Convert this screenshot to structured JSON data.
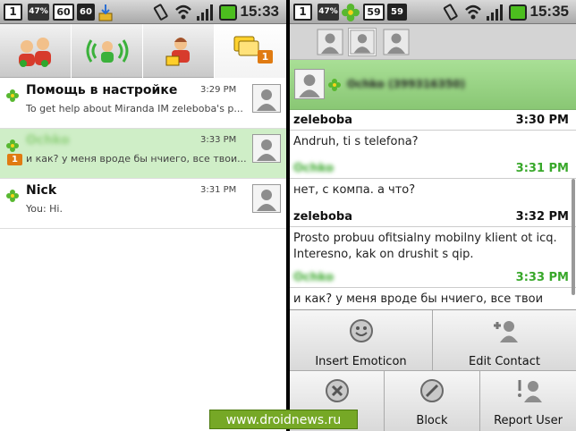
{
  "left_screen": {
    "status": {
      "notif_count": "1",
      "battery": "47%",
      "box1": "60",
      "box2": "60",
      "time": "15:33"
    },
    "tabs": [
      {
        "name": "contacts-tab"
      },
      {
        "name": "status-tab"
      },
      {
        "name": "account-tab"
      },
      {
        "name": "chats-tab",
        "badge": "1"
      }
    ],
    "chats": [
      {
        "name": "Помощь в настройке",
        "time": "3:29 PM",
        "preview": "To get help about Miranda IM zeleboba's p..."
      },
      {
        "name": "Ochko",
        "time": "3:33 PM",
        "preview": "и как? у меня вроде бы нчиего, все твои...",
        "badge": "1"
      },
      {
        "name": "Nick",
        "time": "3:31 PM",
        "preview": "You: Hi."
      }
    ]
  },
  "right_screen": {
    "status": {
      "notif_count": "1",
      "battery": "47%",
      "box1": "59",
      "box2": "59",
      "time": "15:35"
    },
    "contact": {
      "name": "Ochko (399316350)"
    },
    "messages": [
      {
        "from": "zeleboba",
        "time": "3:30 PM",
        "text": "Andruh, ti s telefona?",
        "mine": true
      },
      {
        "from": "Ochko",
        "time": "3:31 PM",
        "text": "нет, с компа. а что?",
        "mine": false
      },
      {
        "from": "zeleboba",
        "time": "3:32 PM",
        "text": "Prosto probuu ofitsialny mobilny klient ot icq. Interesno, kak on drushit s qip.",
        "mine": true
      },
      {
        "from": "Ochko",
        "time": "3:33 PM",
        "text": "и как? у меня вроде бы нчиего, все твои",
        "mine": false
      }
    ],
    "menu": {
      "insert_emoticon": "Insert Emoticon",
      "edit_contact": "Edit Contact",
      "close": "Close",
      "block": "Block",
      "report_user": "Report User"
    }
  },
  "watermark": "www.droidnews.ru",
  "colors": {
    "accent_green": "#38a82a",
    "highlight_row": "#cfeec7",
    "badge_orange": "#e07b12"
  }
}
